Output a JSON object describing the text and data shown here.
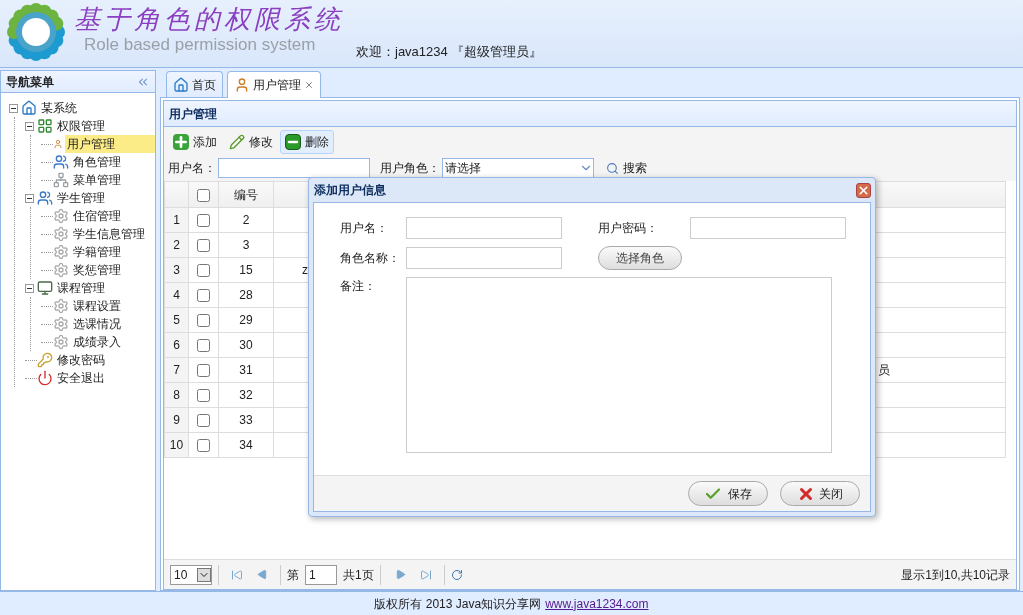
{
  "header": {
    "title": "基于角色的权限系统",
    "subtitle": "Role based permission system",
    "welcome": "欢迎：java1234 『超级管理员』"
  },
  "nav": {
    "title": "导航菜单",
    "tree": [
      {
        "label": "某系统",
        "kind": "home",
        "expanded": true,
        "selected": false,
        "children": [
          {
            "label": "权限管理",
            "kind": "module",
            "expanded": true,
            "selected": false,
            "children": [
              {
                "label": "用户管理",
                "kind": "user",
                "selected": true
              },
              {
                "label": "角色管理",
                "kind": "users",
                "selected": false
              },
              {
                "label": "菜单管理",
                "kind": "tree",
                "selected": false
              }
            ]
          },
          {
            "label": "学生管理",
            "kind": "users",
            "expanded": true,
            "selected": false,
            "children": [
              {
                "label": "住宿管理",
                "kind": "cog",
                "selected": false
              },
              {
                "label": "学生信息管理",
                "kind": "cog",
                "selected": false
              },
              {
                "label": "学籍管理",
                "kind": "cog",
                "selected": false
              },
              {
                "label": "奖惩管理",
                "kind": "cog",
                "selected": false
              }
            ]
          },
          {
            "label": "课程管理",
            "kind": "monitor",
            "expanded": true,
            "selected": false,
            "children": [
              {
                "label": "课程设置",
                "kind": "cog",
                "selected": false
              },
              {
                "label": "选课情况",
                "kind": "cog",
                "selected": false
              },
              {
                "label": "成绩录入",
                "kind": "cog",
                "selected": false
              }
            ]
          },
          {
            "label": "修改密码",
            "kind": "key",
            "selected": false
          },
          {
            "label": "安全退出",
            "kind": "exit",
            "selected": false
          }
        ]
      }
    ]
  },
  "tabs": [
    {
      "label": "首页",
      "kind": "home",
      "selected": false,
      "closable": false
    },
    {
      "label": "用户管理",
      "kind": "user",
      "selected": true,
      "closable": true
    }
  ],
  "panel": {
    "title": "用户管理",
    "toolbar": [
      {
        "label": "添加",
        "kind": "add",
        "hovered": false
      },
      {
        "label": "修改",
        "kind": "edit",
        "hovered": false
      },
      {
        "label": "删除",
        "kind": "delete",
        "hovered": true
      }
    ],
    "search": {
      "username_label": "用户名：",
      "role_label": "用户角色：",
      "role_value": "请选择",
      "button": "搜索"
    },
    "grid": {
      "header_checked": false,
      "columns": [
        "编号"
      ],
      "rows": [
        {
          "number": "1",
          "checked": false,
          "id": "2"
        },
        {
          "number": "2",
          "checked": false,
          "id": "3"
        },
        {
          "number": "3",
          "checked": false,
          "id": "15",
          "column_3": "z"
        },
        {
          "number": "4",
          "checked": false,
          "id": "28"
        },
        {
          "number": "5",
          "checked": false,
          "id": "29"
        },
        {
          "number": "6",
          "checked": false,
          "id": "30"
        },
        {
          "number": "7",
          "checked": false,
          "id": "31",
          "column_4": "员"
        },
        {
          "number": "8",
          "checked": false,
          "id": "32"
        },
        {
          "number": "9",
          "checked": false,
          "id": "33"
        },
        {
          "number": "10",
          "checked": false,
          "id": "34"
        }
      ]
    },
    "pager": {
      "page_size": "10",
      "page_prefix": "第",
      "page": "1",
      "page_total": "共1页",
      "summary": "显示1到10,共10记录"
    }
  },
  "dialog": {
    "title": "添加用户信息",
    "username_label": "用户名：",
    "password_label": "用户密码：",
    "role_label": "角色名称：",
    "choose_role": "选择角色",
    "remark_label": "备注：",
    "save": "保存",
    "close": "关闭"
  },
  "footer": {
    "text": "版权所有 2013 Java知识分享网",
    "link": "www.java1234.com"
  }
}
